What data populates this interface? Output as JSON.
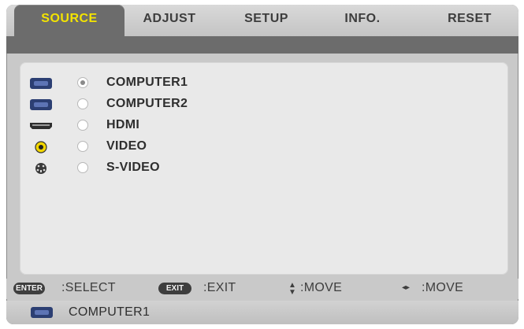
{
  "tabs": [
    {
      "label": "SOURCE",
      "active": true
    },
    {
      "label": "ADJUST"
    },
    {
      "label": "SETUP"
    },
    {
      "label": "INFO."
    },
    {
      "label": "RESET"
    }
  ],
  "sources": [
    {
      "label": "COMPUTER1",
      "icon": "computer-port-icon",
      "selected": true
    },
    {
      "label": "COMPUTER2",
      "icon": "computer-port-icon"
    },
    {
      "label": "HDMI",
      "icon": "hdmi-port-icon"
    },
    {
      "label": "VIDEO",
      "icon": "video-rca-icon"
    },
    {
      "label": "S-VIDEO",
      "icon": "s-video-port-icon"
    }
  ],
  "help": {
    "enter_key": "ENTER",
    "select": ":SELECT",
    "exit_key": "EXIT",
    "exit": ":EXIT",
    "move_vertical": ":MOVE",
    "move_horizontal": ":MOVE"
  },
  "status": {
    "source": "COMPUTER1",
    "icon": "computer-port-icon"
  },
  "colors": {
    "active_tab_text": "#f4e400",
    "active_tab_bg": "#6c6c6c",
    "panel": "#e9e9e9",
    "frame": "#c9c9c9"
  }
}
